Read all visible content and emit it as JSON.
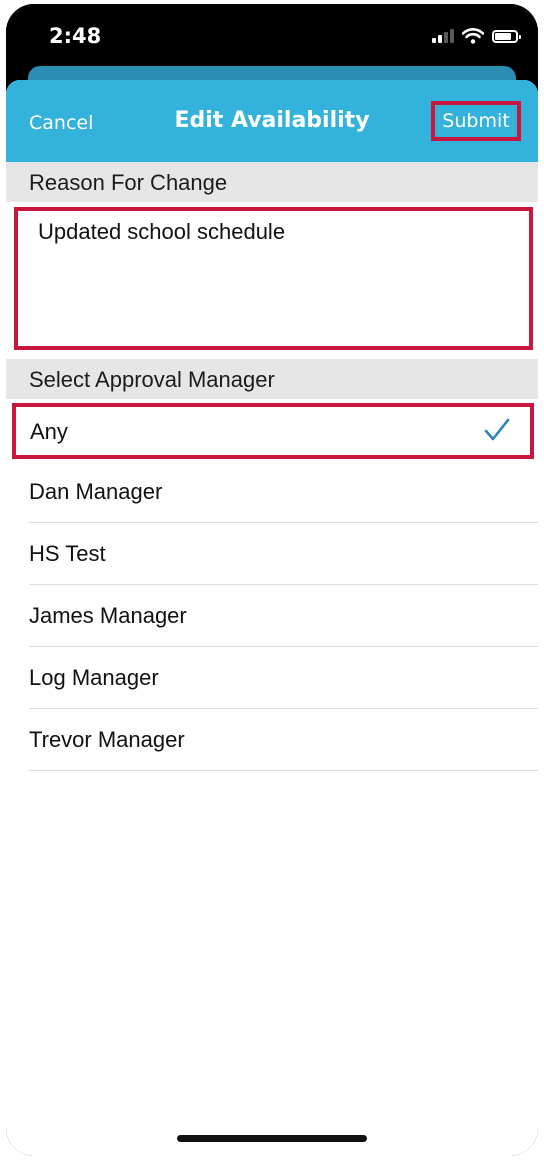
{
  "status_bar": {
    "time": "2:48"
  },
  "nav": {
    "cancel_label": "Cancel",
    "title": "Edit Availability",
    "submit_label": "Submit"
  },
  "reason": {
    "header": "Reason For Change",
    "value": "Updated school schedule"
  },
  "managers": {
    "header": "Select Approval Manager",
    "items": [
      {
        "label": "Any",
        "selected": true
      },
      {
        "label": "Dan Manager"
      },
      {
        "label": "HS Test"
      },
      {
        "label": "James Manager"
      },
      {
        "label": "Log Manager"
      },
      {
        "label": "Trevor Manager"
      }
    ]
  },
  "colors": {
    "accent": "#33b2dc",
    "highlight": "#c8163f",
    "check": "#2a86b5"
  },
  "icons": [
    "signal-icon",
    "wifi-icon",
    "battery-icon",
    "checkmark-icon"
  ]
}
